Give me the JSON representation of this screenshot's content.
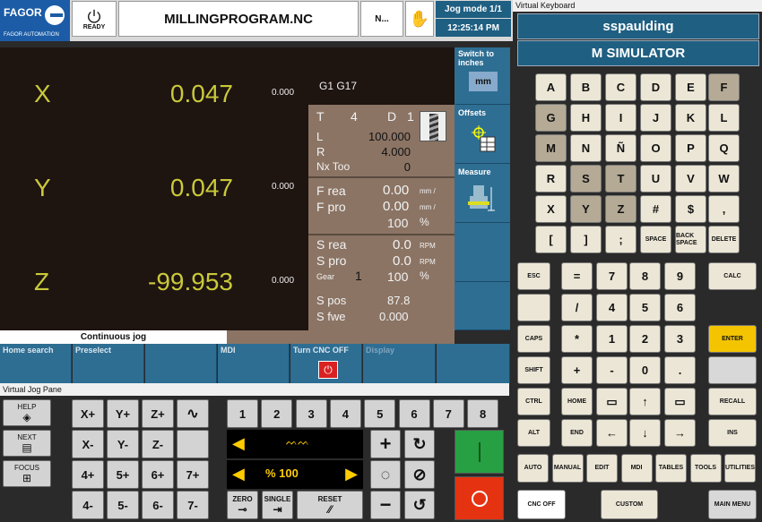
{
  "header": {
    "logo": "FAGOR",
    "logo_sub": "FAGOR AUTOMATION",
    "ready": "READY",
    "program": "MILLINGPROGRAM.NC",
    "n": "N...",
    "jog_mode": "Jog mode 1/1",
    "time": "12:25:14 PM"
  },
  "axes": [
    {
      "name": "X",
      "value": "0.047",
      "small": "0.000"
    },
    {
      "name": "Y",
      "value": "0.047",
      "small": "0.000"
    },
    {
      "name": "Z",
      "value": "-99.953",
      "small": "0.000"
    }
  ],
  "gcode": "G1 G17",
  "tool": {
    "t": "T",
    "t_val": "4",
    "d": "D",
    "d_val": "1",
    "l": "L",
    "l_val": "100.000",
    "r": "R",
    "r_val": "4.000",
    "nx": "Nx Too",
    "nx_val": "0"
  },
  "feed": {
    "frea": "F rea",
    "frea_val": "0.00",
    "frea_unit": "mm /",
    "fpro": "F pro",
    "fpro_val": "0.00",
    "fpro_unit": "mm /",
    "pct": "100",
    "pct_unit": "%"
  },
  "spindle": {
    "srea": "S rea",
    "srea_val": "0.0",
    "srea_unit": "RPM",
    "spro": "S pro",
    "spro_val": "0.0",
    "spro_unit": "RPM",
    "gear": "Gear",
    "gear_val": "1",
    "pct": "100",
    "pct_unit": "%",
    "spos": "S pos",
    "spos_val": "87.8",
    "sfwe": "S fwe",
    "sfwe_val": "0.000"
  },
  "side": {
    "switch": "Switch to inches",
    "mm": "mm",
    "offsets": "Offsets",
    "measure": "Measure"
  },
  "cont_jog": "Continuous jog",
  "softkeys": [
    "Home search",
    "Preselect",
    "",
    "MDI",
    "Turn CNC OFF",
    "Display",
    ""
  ],
  "jog_pane": {
    "title": "Virtual Jog Pane",
    "help": "HELP",
    "next": "NEXT",
    "focus": "FOCUS",
    "keys_r1": [
      "X+",
      "Y+",
      "Z+"
    ],
    "keys_r2": [
      "X-",
      "Y-",
      "Z-"
    ],
    "keys_r3": [
      "4+",
      "5+",
      "6+",
      "7+"
    ],
    "keys_r4": [
      "4-",
      "5-",
      "6-",
      "7-"
    ],
    "nums": [
      "1",
      "2",
      "3",
      "4",
      "5",
      "6",
      "7",
      "8"
    ],
    "feed_pct": "% 100",
    "zero": "ZERO",
    "single": "SINGLE",
    "reset": "RESET"
  },
  "kb": {
    "title": "Virtual Keyboard",
    "user": "sspaulding",
    "mode": "M SIMULATOR",
    "letters": [
      [
        "A",
        "B",
        "C",
        "D",
        "E",
        "F"
      ],
      [
        "G",
        "H",
        "I",
        "J",
        "K",
        "L"
      ],
      [
        "M",
        "N",
        "Ñ",
        "O",
        "P",
        "Q"
      ],
      [
        "R",
        "S",
        "T",
        "U",
        "V",
        "W"
      ],
      [
        "X",
        "Y",
        "Z",
        "#",
        "$",
        ","
      ]
    ],
    "row6": [
      "[",
      "]",
      ";",
      "SPACE",
      "BACK SPACE",
      "DELETE"
    ],
    "esc": "ESC",
    "calc": "CALC",
    "caps": "CAPS",
    "enter": "ENTER",
    "shift": "SHIFT",
    "recall": "RECALL",
    "ctrl": "CTRL",
    "home": "HOME",
    "alt": "ALT",
    "end": "END",
    "ins": "INS",
    "nums": [
      [
        "=",
        "7",
        "8",
        "9"
      ],
      [
        "/",
        "4",
        "5",
        "6"
      ],
      [
        "*",
        "1",
        "2",
        "3"
      ],
      [
        "+",
        "-",
        "0",
        "."
      ]
    ],
    "modes": [
      "AUTO",
      "MANUAL",
      "EDIT",
      "MDI",
      "TABLES",
      "TOOLS",
      "UTILITIES"
    ],
    "cncoff": "CNC OFF",
    "custom": "CUSTOM",
    "mainmenu": "MAIN MENU"
  },
  "colors": {
    "accent": "#1f5f82",
    "panel": "#8b7464",
    "dark": "#1e1410"
  }
}
